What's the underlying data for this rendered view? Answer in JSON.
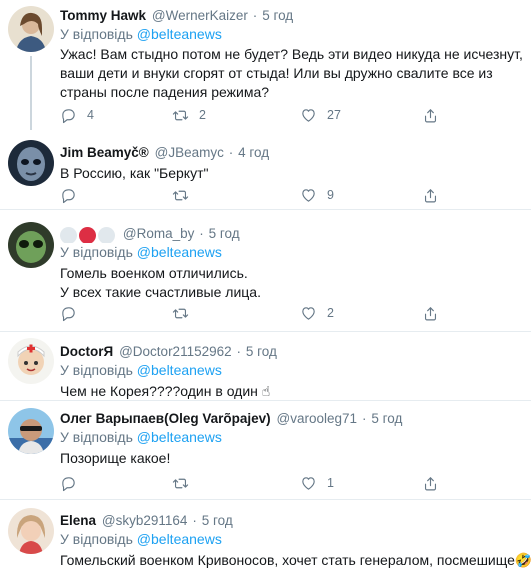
{
  "tweets": [
    {
      "name": "Tommy Hawk",
      "handle": "@WernerKaizer",
      "dot": "·",
      "time": "5 год",
      "reply_prefix": "У відповідь",
      "reply_to": "@belteanews",
      "text": "Ужас! Вам стыдно потом не будет? Ведь эти видео никуда не исчезнут, ваши дети и внуки сгорят от стыда! Или вы дружно свалите все из страны после падения режима?",
      "replies": "4",
      "retweets": "2",
      "likes": "27",
      "avatar": "avatar-woman-illustration"
    },
    {
      "name": "Jim Beamyč®",
      "handle": "@JBeamyc",
      "dot": "·",
      "time": "4 год",
      "text": "В Россию, как \"Беркут\"",
      "replies": "",
      "retweets": "",
      "likes": "9",
      "avatar": "avatar-alien-face"
    },
    {
      "name": "",
      "name_emoji": [
        "white-circle",
        "red-circle",
        "white-circle"
      ],
      "handle": "@Roma_by",
      "dot": "·",
      "time": "5 год",
      "reply_prefix": "У відповідь",
      "reply_to": "@belteanews",
      "text": "Гомель военком отличились.\nУ всех такие счастливые лица.",
      "replies": "",
      "retweets": "",
      "likes": "2",
      "avatar": "avatar-green-alien"
    },
    {
      "name": "DoctorЯ",
      "handle": "@Doctor21152962",
      "dot": "·",
      "time": "5 год",
      "reply_prefix": "У відповідь",
      "reply_to": "@belteanews",
      "text": "Чем не Корея????один в один ☝",
      "avatar": "avatar-doctor-cartoon"
    },
    {
      "name": "Олег Варыпаев(Oleg Varõpajev)",
      "handle": "@varooleg71",
      "dot": "·",
      "time": "5 год",
      "reply_prefix": "У відповідь",
      "reply_to": "@belteanews",
      "text": "Позорище какое!",
      "replies": "",
      "retweets": "",
      "likes": "1",
      "avatar": "avatar-man-sunglasses"
    },
    {
      "name": "Elena",
      "handle": "@skyb291164",
      "dot": "·",
      "time": "5 год",
      "reply_prefix": "У відповідь",
      "reply_to": "@belteanews",
      "text": "Гомельский военком Кривоносов, хочет стать генералом, посмешище🤣",
      "avatar": "avatar-woman-photo"
    }
  ],
  "colors": {
    "link": "#1da1f2",
    "muted": "#657786",
    "border": "#e6ecf0",
    "thread": "#ccd6dd"
  },
  "icons": [
    "reply-icon",
    "retweet-icon",
    "like-icon",
    "share-icon"
  ]
}
